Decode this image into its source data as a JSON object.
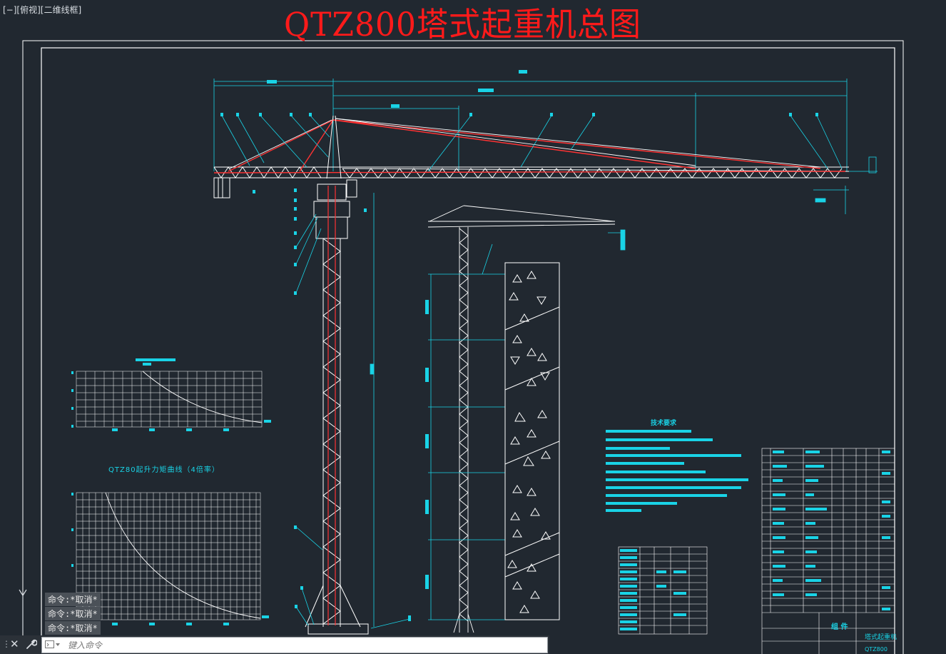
{
  "viewport": {
    "label": "[−][俯视][二维线框]"
  },
  "drawing": {
    "title": "QTZ800塔式起重机总图",
    "title_color": "#ff1a1a",
    "line_color": "#19d3e6",
    "structure_color": "#ffffff",
    "member_color": "#ff3333"
  },
  "annotations": {
    "moment_chart_caption": "QTZ80起升力矩曲线（4倍率）",
    "tech_requirements_title": "技术要求",
    "title_block_part": "组 件",
    "title_block_name": "塔式起重机",
    "title_block_code": "QTZ800"
  },
  "command_line": {
    "history": [
      {
        "prefix": "命令:",
        "text": "*取消*"
      },
      {
        "prefix": "命令:",
        "text": "*取消*"
      },
      {
        "prefix": "命令:",
        "text": "*取消*"
      }
    ],
    "placeholder": "键入命令",
    "value": ""
  },
  "icons": {
    "grip": "grip-icon",
    "close": "close-icon",
    "customize": "wrench-icon",
    "prompt": "command-prompt-icon",
    "ucs_axis": "ucs-y-axis-icon"
  }
}
